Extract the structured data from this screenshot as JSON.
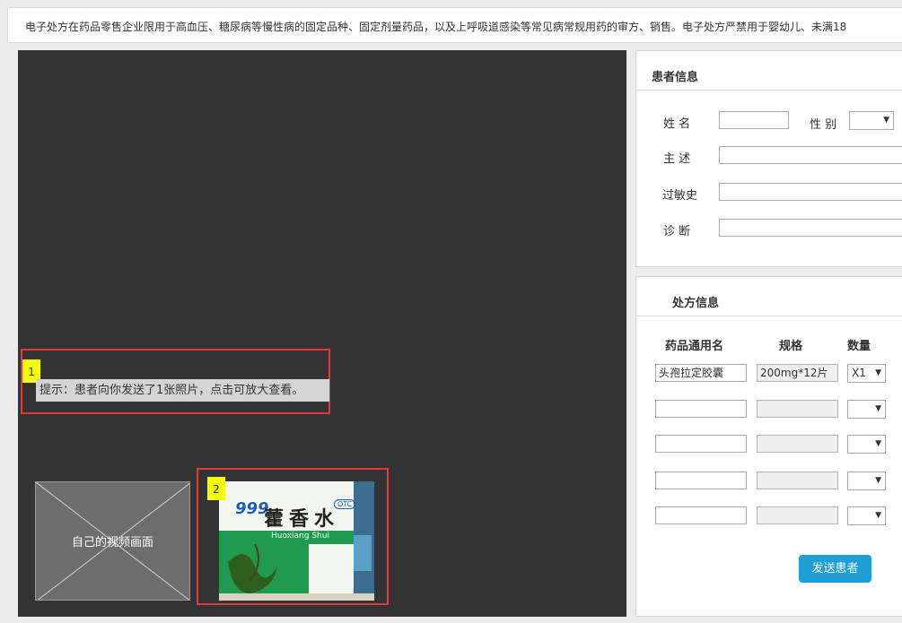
{
  "notice": {
    "text": "电子处方在药品零售企业限用于高血压、糖尿病等慢性病的固定品种、固定剂量药品，以及上呼吸道感染等常见病常规用药的审方、销售。电子处方严禁用于婴幼儿、未满18"
  },
  "video": {
    "hint_badge": "1",
    "hint_text": "提示：患者向你发送了1张照片，点击可放大查看。",
    "self_video_label": "自己的视频画面",
    "photo_badge": "2",
    "photo": {
      "brand_number": "999",
      "product_name": "藿香水",
      "product_pinyin": "Huoxiang Shui",
      "otc_mark": "OTC"
    }
  },
  "patient": {
    "title": "患者信息",
    "name_label": "姓  名",
    "gender_label": "性 别",
    "complaint_label": "主  述",
    "allergy_label": "过敏史",
    "diagnosis_label": "诊  断",
    "name_value": "",
    "gender_value": "",
    "complaint_value": "",
    "allergy_value": "",
    "diagnosis_value": ""
  },
  "prescription": {
    "title": "处方信息",
    "columns": {
      "drug": "药品通用名",
      "spec": "规格",
      "qty": "数量"
    },
    "rows": [
      {
        "drug": "头孢拉定胶囊",
        "spec": "200mg*12片",
        "qty": "X1"
      },
      {
        "drug": "",
        "spec": "",
        "qty": ""
      },
      {
        "drug": "",
        "spec": "",
        "qty": ""
      },
      {
        "drug": "",
        "spec": "",
        "qty": ""
      },
      {
        "drug": "",
        "spec": "",
        "qty": ""
      }
    ],
    "send_label": "发送患者"
  },
  "colors": {
    "video_bg": "#333333",
    "highlight_border": "#e53935",
    "badge_yellow": "#f5ff00",
    "send_button": "#1d9fd6"
  }
}
